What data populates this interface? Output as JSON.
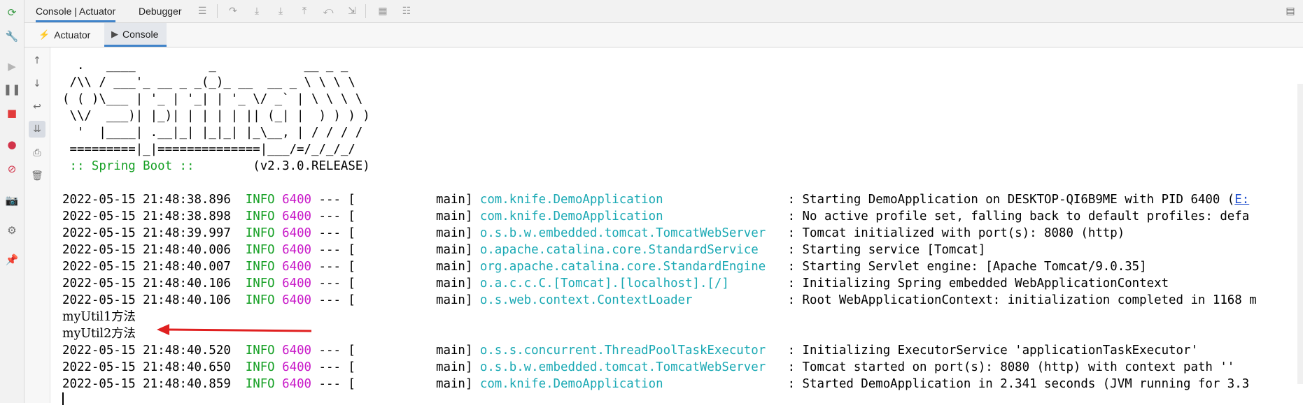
{
  "top_tabs": [
    "Console | Actuator",
    "Debugger"
  ],
  "sub_tabs": [
    {
      "icon": "actuator-icon",
      "label": "Actuator"
    },
    {
      "icon": "console-icon",
      "label": "Console"
    }
  ],
  "banner": [
    "  .   ____          _            __ _ _",
    " /\\\\ / ___'_ __ _ _(_)_ __  __ _ \\ \\ \\ \\",
    "( ( )\\___ | '_ | '_| | '_ \\/ _` | \\ \\ \\ \\",
    " \\\\/  ___)| |_)| | | | | || (_| |  ) ) ) )",
    "  '  |____| .__|_| |_|_| |_\\__, | / / / /",
    " =========|_|==============|___/=/_/_/_/"
  ],
  "banner_boot_label": " :: Spring Boot :: ",
  "banner_version": "       (v2.3.0.RELEASE)",
  "log_lines": [
    {
      "ts": "2022-05-15 21:48:38.896",
      "level": "INFO",
      "pid": "6400",
      "sep": " --- [           main] ",
      "logger": "com.knife.DemoApplication                ",
      "msg": " : Starting DemoApplication on DESKTOP-QI6B9ME with PID 6400 (",
      "link": "E:"
    },
    {
      "ts": "2022-05-15 21:48:38.898",
      "level": "INFO",
      "pid": "6400",
      "sep": " --- [           main] ",
      "logger": "com.knife.DemoApplication                ",
      "msg": " : No active profile set, falling back to default profiles: defa",
      "link": ""
    },
    {
      "ts": "2022-05-15 21:48:39.997",
      "level": "INFO",
      "pid": "6400",
      "sep": " --- [           main] ",
      "logger": "o.s.b.w.embedded.tomcat.TomcatWebServer  ",
      "msg": " : Tomcat initialized with port(s): 8080 (http)",
      "link": ""
    },
    {
      "ts": "2022-05-15 21:48:40.006",
      "level": "INFO",
      "pid": "6400",
      "sep": " --- [           main] ",
      "logger": "o.apache.catalina.core.StandardService   ",
      "msg": " : Starting service [Tomcat]",
      "link": ""
    },
    {
      "ts": "2022-05-15 21:48:40.007",
      "level": "INFO",
      "pid": "6400",
      "sep": " --- [           main] ",
      "logger": "org.apache.catalina.core.StandardEngine  ",
      "msg": " : Starting Servlet engine: [Apache Tomcat/9.0.35]",
      "link": ""
    },
    {
      "ts": "2022-05-15 21:48:40.106",
      "level": "INFO",
      "pid": "6400",
      "sep": " --- [           main] ",
      "logger": "o.a.c.c.C.[Tomcat].[localhost].[/]       ",
      "msg": " : Initializing Spring embedded WebApplicationContext",
      "link": ""
    },
    {
      "ts": "2022-05-15 21:48:40.106",
      "level": "INFO",
      "pid": "6400",
      "sep": " --- [           main] ",
      "logger": "o.s.web.context.ContextLoader            ",
      "msg": " : Root WebApplicationContext: initialization completed in 1168 m",
      "link": ""
    }
  ],
  "plain_lines": [
    "myUtil1方法",
    "myUtil2方法"
  ],
  "log_lines_2": [
    {
      "ts": "2022-05-15 21:48:40.520",
      "level": "INFO",
      "pid": "6400",
      "sep": " --- [           main] ",
      "logger": "o.s.s.concurrent.ThreadPoolTaskExecutor  ",
      "msg": " : Initializing ExecutorService 'applicationTaskExecutor'",
      "link": ""
    },
    {
      "ts": "2022-05-15 21:48:40.650",
      "level": "INFO",
      "pid": "6400",
      "sep": " --- [           main] ",
      "logger": "o.s.b.w.embedded.tomcat.TomcatWebServer  ",
      "msg": " : Tomcat started on port(s): 8080 (http) with context path ''",
      "link": ""
    },
    {
      "ts": "2022-05-15 21:48:40.859",
      "level": "INFO",
      "pid": "6400",
      "sep": " --- [           main] ",
      "logger": "com.knife.DemoApplication                ",
      "msg": " : Started DemoApplication in 2.341 seconds (JVM running for 3.3",
      "link": ""
    }
  ],
  "colors": {
    "info": "#16a025",
    "pid": "#c818c8",
    "logger": "#1aa9b4",
    "tab_accent": "#4083c9",
    "arrow": "#e02020"
  }
}
